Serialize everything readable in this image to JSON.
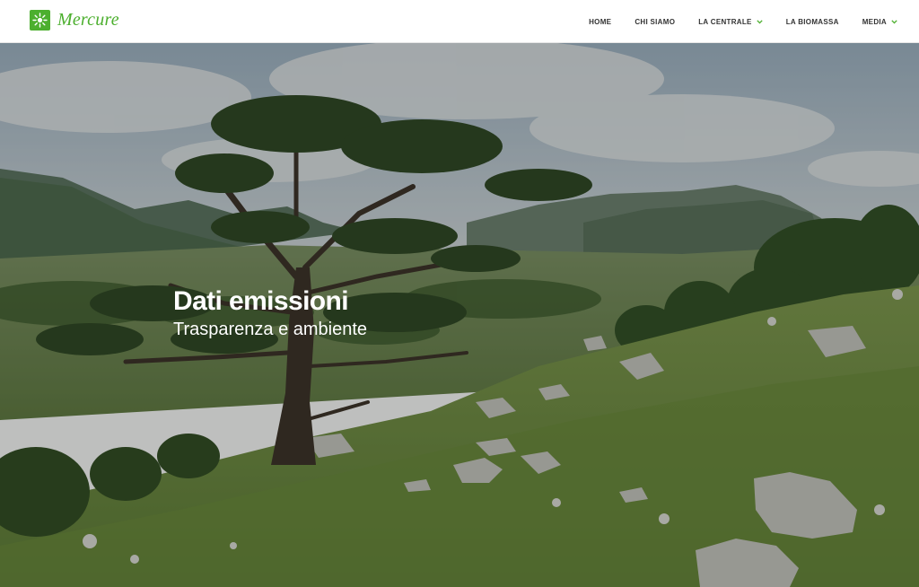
{
  "brand": {
    "name": "Mercure",
    "accent_color": "#4caf2e",
    "logo_icon": "sun-icon"
  },
  "nav": {
    "items": [
      {
        "label": "HOME",
        "has_dropdown": false
      },
      {
        "label": "CHI SIAMO",
        "has_dropdown": false
      },
      {
        "label": "LA CENTRALE",
        "has_dropdown": true
      },
      {
        "label": "LA BIOMASSA",
        "has_dropdown": false
      },
      {
        "label": "MEDIA",
        "has_dropdown": true
      }
    ],
    "dropdown_icon": "chevron-down-icon"
  },
  "hero": {
    "title": "Dati emissioni",
    "subtitle": "Trasparenza e ambiente",
    "image": "mountain-landscape-with-pine-tree"
  }
}
